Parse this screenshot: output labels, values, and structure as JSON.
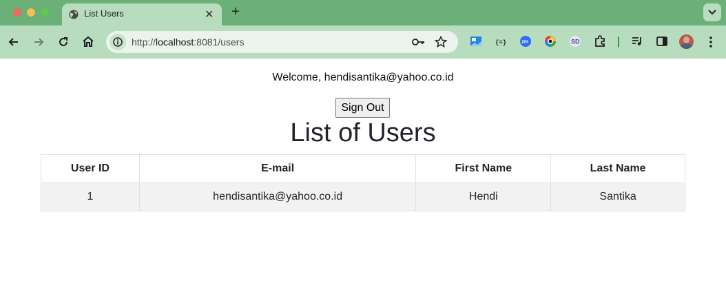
{
  "browser": {
    "tab": {
      "title": "List Users",
      "close_glyph": "✕"
    },
    "new_tab_glyph": "+",
    "url": {
      "scheme": "http://",
      "host": "localhost",
      "rest": ":8081/users"
    },
    "icons": [
      "back-icon",
      "forward-icon",
      "reload-icon",
      "home-icon",
      "site-info-icon",
      "password-key-icon",
      "bookmark-star-icon",
      "extensions-icon",
      "reading-list-icon",
      "side-panel-icon",
      "menu-dots-icon"
    ]
  },
  "page": {
    "welcome": "Welcome, hendisantika@yahoo.co.id",
    "signout_label": "Sign Out",
    "title": "List of Users",
    "table": {
      "headers": [
        "User ID",
        "E-mail",
        "First Name",
        "Last Name"
      ],
      "rows": [
        {
          "id": "1",
          "email": "hendisantika@yahoo.co.id",
          "first_name": "Hendi",
          "last_name": "Santika"
        }
      ]
    }
  },
  "colors": {
    "tabstrip": "#6bb076",
    "toolbar": "#b8dcbe",
    "text": "#212529"
  }
}
